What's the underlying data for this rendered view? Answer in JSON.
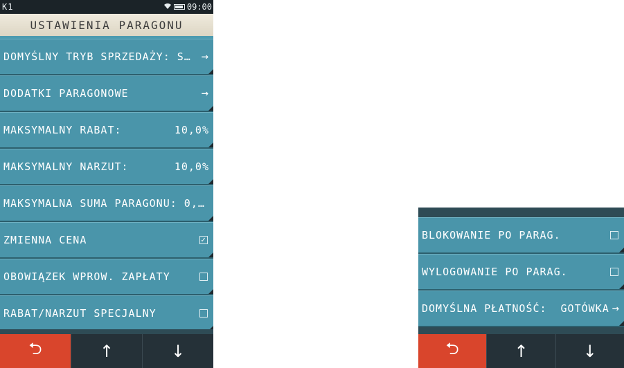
{
  "status": {
    "channel": "K1",
    "time": "09:00",
    "wifi_icon": "wifi-icon",
    "battery_icon": "battery-icon"
  },
  "title": "USTAWIENIA PARAGONU",
  "left_rows": [
    {
      "label": "DOMYŚLNY TRYB SPRZEDAŻY: S…",
      "value": "",
      "control": "arrow"
    },
    {
      "label": "DODATKI PARAGONOWE",
      "value": "",
      "control": "arrow"
    },
    {
      "label": "MAKSYMALNY RABAT:",
      "value": "10,0%",
      "control": "none"
    },
    {
      "label": "MAKSYMALNY NARZUT:",
      "value": "10,0%",
      "control": "none"
    },
    {
      "label": "MAKSYMALNA SUMA PARAGONU: 0,…",
      "value": "",
      "control": "none"
    },
    {
      "label": "ZMIENNA CENA",
      "value": "",
      "control": "checkbox",
      "checked": true
    },
    {
      "label": "OBOWIĄZEK WPROW. ZAPŁATY",
      "value": "",
      "control": "checkbox",
      "checked": false
    },
    {
      "label": "RABAT/NARZUT SPECJALNY",
      "value": "",
      "control": "checkbox",
      "checked": false
    }
  ],
  "right_rows": [
    {
      "label": "BLOKOWANIE PO PARAG.",
      "value": "",
      "control": "checkbox",
      "checked": false
    },
    {
      "label": "WYLOGOWANIE PO PARAG.",
      "value": "",
      "control": "checkbox",
      "checked": false
    },
    {
      "label": "DOMYŚLNA PŁATNOŚĆ:",
      "value": "GOTÓWKA",
      "control": "arrow"
    }
  ],
  "nav": {
    "back": "⮌",
    "up": "↑",
    "down": "↓"
  },
  "glyphs": {
    "arrow": "→",
    "check": "✓"
  },
  "colors": {
    "row": "#4a95aa",
    "back_button": "#d9452c",
    "title_bg": "#e8e2d2"
  }
}
